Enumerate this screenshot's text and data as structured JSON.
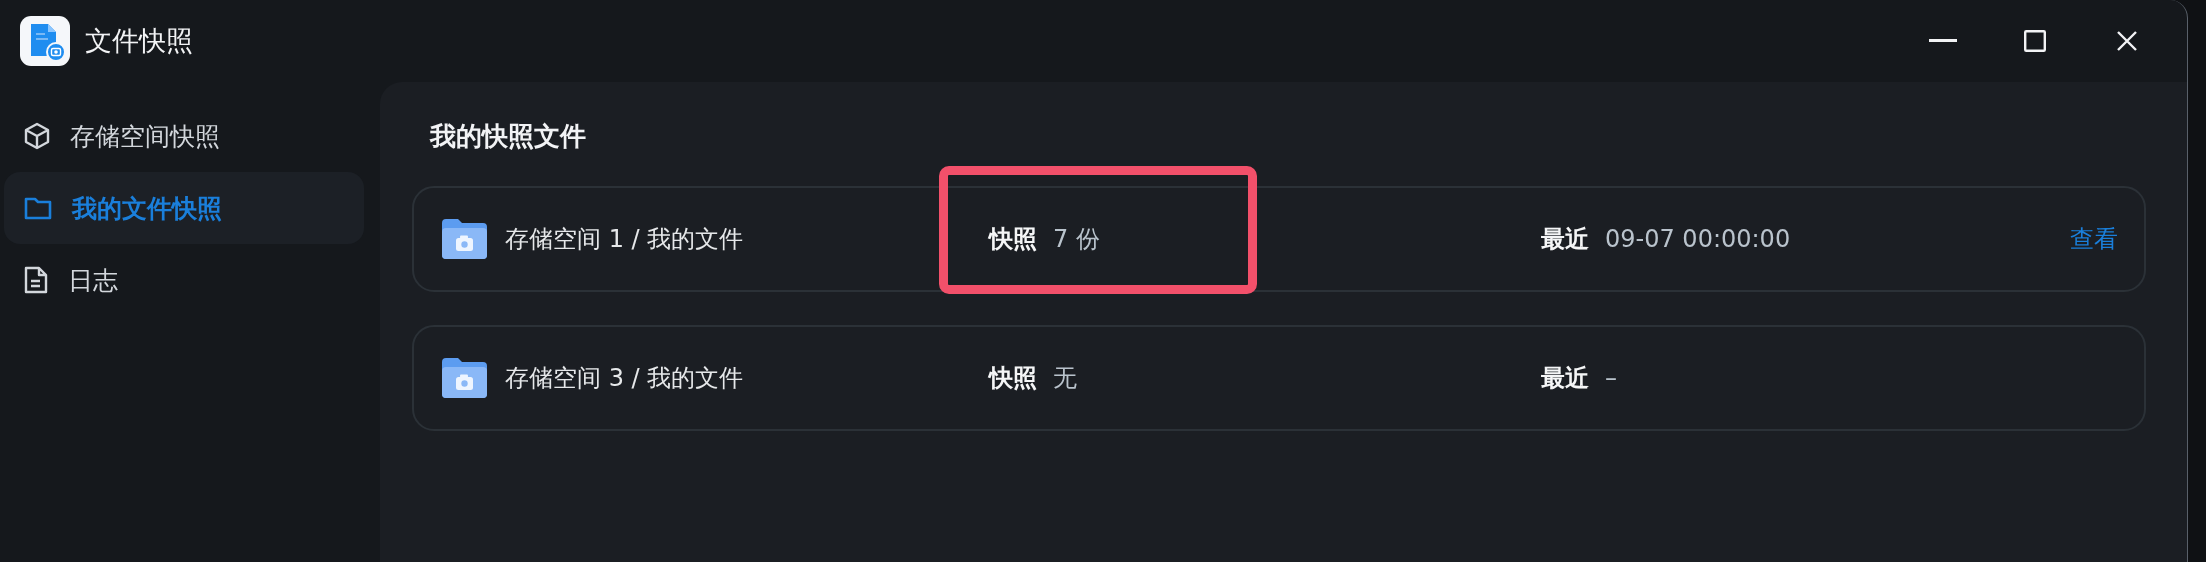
{
  "window": {
    "title": "文件快照"
  },
  "sidebar": {
    "items": [
      {
        "label": "存储空间快照",
        "kind": "cube",
        "selected": false
      },
      {
        "label": "我的文件快照",
        "kind": "folder",
        "selected": true
      },
      {
        "label": "日志",
        "kind": "document",
        "selected": false
      }
    ]
  },
  "main": {
    "heading": "我的快照文件",
    "rows": [
      {
        "name": "存储空间 1 / 我的文件",
        "snapshot_label": "快照",
        "snapshot_value": "7 份",
        "recent_label": "最近",
        "recent_value": "09-07 00:00:00",
        "action": "查看",
        "highlighted": true
      },
      {
        "name": "存储空间 3 / 我的文件",
        "snapshot_label": "快照",
        "snapshot_value": "无",
        "recent_label": "最近",
        "recent_value": "–",
        "highlighted": false
      }
    ]
  }
}
